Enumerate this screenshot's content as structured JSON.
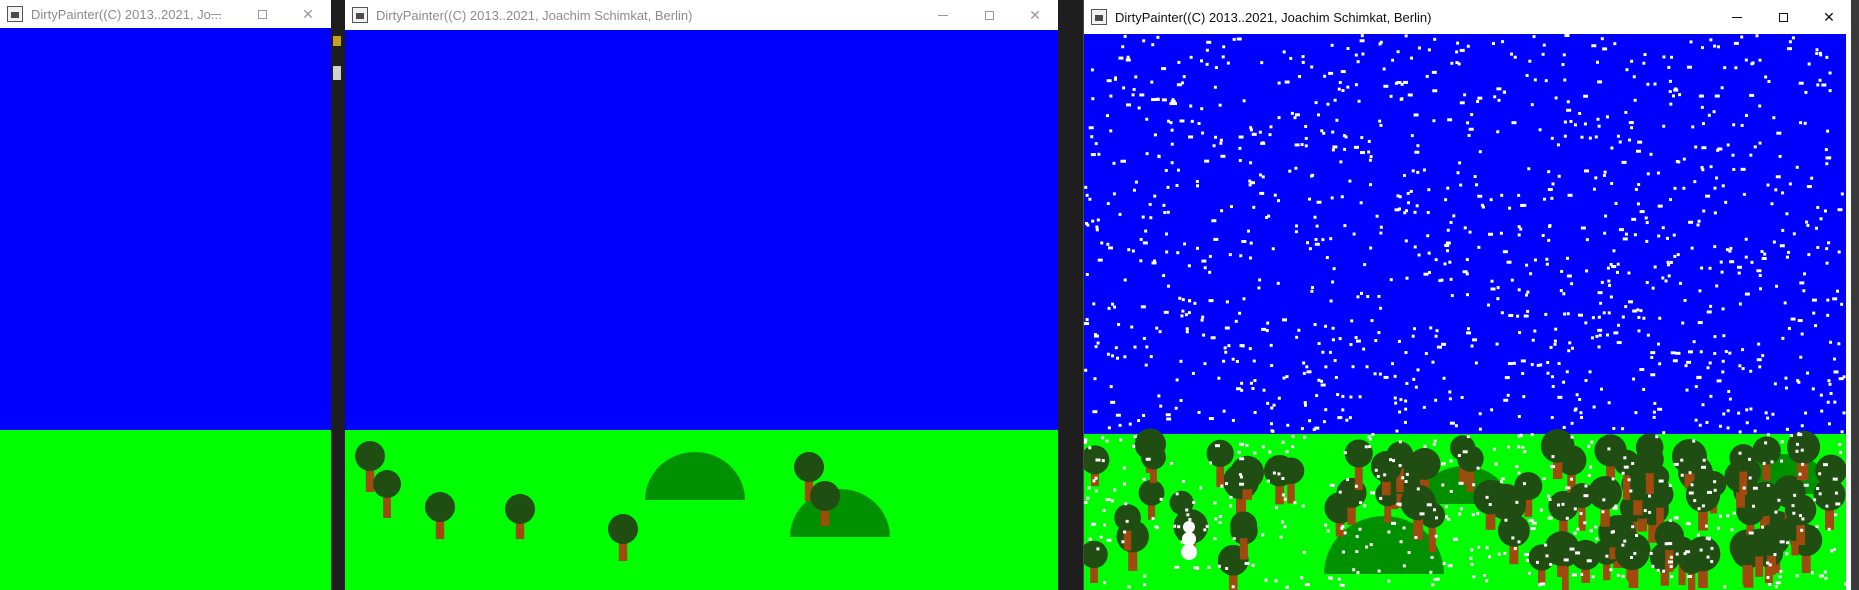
{
  "colors": {
    "sky": "#0000ff",
    "grass": "#00ff00",
    "hill": "#009000",
    "tree_crown": "#1f4d12",
    "tree_trunk": "#a04a10",
    "snow": "#ffffff"
  },
  "windows": [
    {
      "title": "DirtyPainter((C) 2013..2021, Jo...",
      "state": "inactive"
    },
    {
      "title": "DirtyPainter((C) 2013..2021, Joachim Schimkat, Berlin)",
      "state": "inactive"
    },
    {
      "title": "DirtyPainter((C) 2013..2021, Joachim Schimkat, Berlin)",
      "state": "active"
    }
  ],
  "controls": {
    "minimize": "minimize",
    "maximize": "maximize",
    "close": "close"
  },
  "icons": {
    "app": "java-app-icon",
    "minimize": "minimize-icon",
    "maximize": "maximize-icon",
    "close": "close-icon"
  }
}
